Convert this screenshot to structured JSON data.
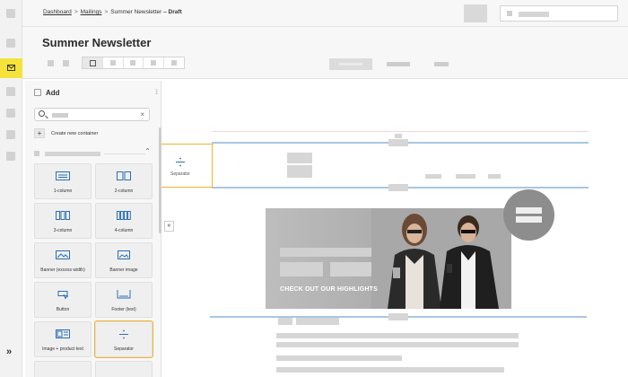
{
  "breadcrumb": {
    "items": [
      "Dashboard",
      "Mailings",
      "Summer Newsletter"
    ],
    "current_suffix": "– Draft",
    "separator": ">"
  },
  "page": {
    "title": "Summer Newsletter"
  },
  "rail": {
    "collapse_label": "»",
    "active_icon": "mail-icon"
  },
  "add_panel": {
    "title": "Add",
    "search": {
      "clear_label": "×"
    },
    "create_container_label": "Create new container",
    "panel_toggle": "«",
    "tiles": [
      {
        "label": "1-column",
        "icon": "one-column-icon"
      },
      {
        "label": "2-column",
        "icon": "two-column-icon"
      },
      {
        "label": "3-column",
        "icon": "three-column-icon"
      },
      {
        "label": "4-column",
        "icon": "four-column-icon"
      },
      {
        "label": "Banner (excess width)",
        "icon": "banner-wide-icon"
      },
      {
        "label": "Banner image",
        "icon": "image-icon"
      },
      {
        "label": "Button",
        "icon": "button-icon"
      },
      {
        "label": "Footer (text)",
        "icon": "footer-icon"
      },
      {
        "label": "Image + product text",
        "icon": "image-text-icon"
      },
      {
        "label": "Separator",
        "icon": "separator-icon",
        "highlighted": true
      }
    ]
  },
  "canvas": {
    "drag_ghost_label": "Separator",
    "banner_tagline": "CHECK OUT OUR HIGHLIGHTS"
  },
  "colors": {
    "accent_yellow": "#f5e33a",
    "highlight_orange": "#f0b429",
    "guide_blue": "#a9c6e3",
    "drop_pink": "#f5d6dc",
    "brand_orange": "#e87722"
  }
}
